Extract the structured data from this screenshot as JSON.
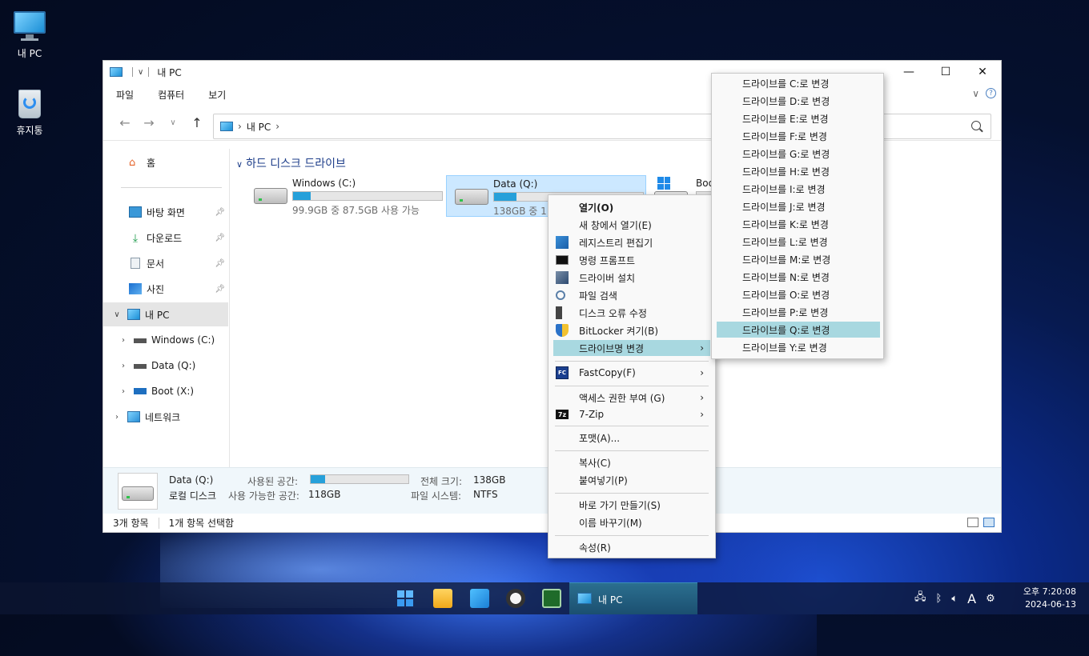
{
  "desktop": {
    "icons": [
      {
        "label": "내 PC"
      },
      {
        "label": "휴지통"
      }
    ]
  },
  "window": {
    "title": "내 PC",
    "controls": {
      "minimize": "—",
      "maximize": "☐",
      "close": "✕"
    },
    "menu": [
      "파일",
      "컴퓨터",
      "보기"
    ],
    "address": {
      "location": "내 PC"
    },
    "nav": {
      "back": "←",
      "forward": "→",
      "recent": "∨",
      "up": "↑"
    }
  },
  "sidebar": {
    "home": "홈",
    "quick": [
      {
        "label": "바탕 화면"
      },
      {
        "label": "다운로드"
      },
      {
        "label": "문서"
      },
      {
        "label": "사진"
      }
    ],
    "this_pc": "내 PC",
    "drives": [
      {
        "label": "Windows (C:)"
      },
      {
        "label": "Data (Q:)"
      },
      {
        "label": "Boot (X:)"
      }
    ],
    "network": "네트워크"
  },
  "content": {
    "group_header": "하드 디스크 드라이브",
    "drives": [
      {
        "name": "Windows (C:)",
        "sub": "99.9GB 중 87.5GB 사용 가능",
        "used_fraction": 0.12
      },
      {
        "name": "Data (Q:)",
        "sub": "138GB 중 11",
        "used_fraction": 0.15
      },
      {
        "name": "Boo",
        "sub": "",
        "used_fraction": 0.0
      }
    ]
  },
  "details": {
    "name": "Data (Q:)",
    "type": "로컬 디스크",
    "used_label": "사용된 공간:",
    "free_label": "사용 가능한 공간:",
    "free_value": "118GB",
    "total_label": "전체 크기:",
    "total_value": "138GB",
    "fs_label": "파일 시스템:",
    "fs_value": "NTFS",
    "used_fraction": 0.15
  },
  "status": {
    "count": "3개 항목",
    "selected": "1개 항목 선택함"
  },
  "context_menu": {
    "items": [
      {
        "label": "열기(O)",
        "bold": true
      },
      {
        "label": "새 창에서 열기(E)"
      },
      {
        "label": "레지스트리 편집기"
      },
      {
        "label": "명령 프롬프트"
      },
      {
        "label": "드라이버 설치"
      },
      {
        "label": "파일 검색"
      },
      {
        "label": "디스크 오류 수정"
      },
      {
        "label": "BitLocker 켜기(B)"
      },
      {
        "label": "드라이브명 변경"
      },
      {
        "label": "FastCopy(F)"
      },
      {
        "label": "액세스 권한 부여 (G)"
      },
      {
        "label": "7-Zip"
      },
      {
        "label": "포맷(A)..."
      },
      {
        "label": "복사(C)"
      },
      {
        "label": "붙여넣기(P)"
      },
      {
        "label": "바로 가기 만들기(S)"
      },
      {
        "label": "이름 바꾸기(M)"
      },
      {
        "label": "속성(R)"
      }
    ]
  },
  "submenu": {
    "items": [
      "드라이브를 C:로 변경",
      "드라이브를 D:로 변경",
      "드라이브를 E:로 변경",
      "드라이브를 F:로 변경",
      "드라이브를 G:로 변경",
      "드라이브를 H:로 변경",
      "드라이브를 I:로 변경",
      "드라이브를 J:로 변경",
      "드라이브를 K:로 변경",
      "드라이브를 L:로 변경",
      "드라이브를 M:로 변경",
      "드라이브를 N:로 변경",
      "드라이브를 O:로 변경",
      "드라이브를 P:로 변경",
      "드라이브를 Q:로 변경",
      "드라이브를 Y:로 변경"
    ],
    "highlighted_index": 14
  },
  "taskbar": {
    "active_label": "내 PC",
    "tray": {
      "ime": "A"
    },
    "clock": {
      "time": "오후 7:20:08",
      "date": "2024-06-13"
    }
  },
  "colors": {
    "accent": "#26a0da",
    "selection": "#cce8ff",
    "menu_highlight": "#a8d8e0"
  }
}
